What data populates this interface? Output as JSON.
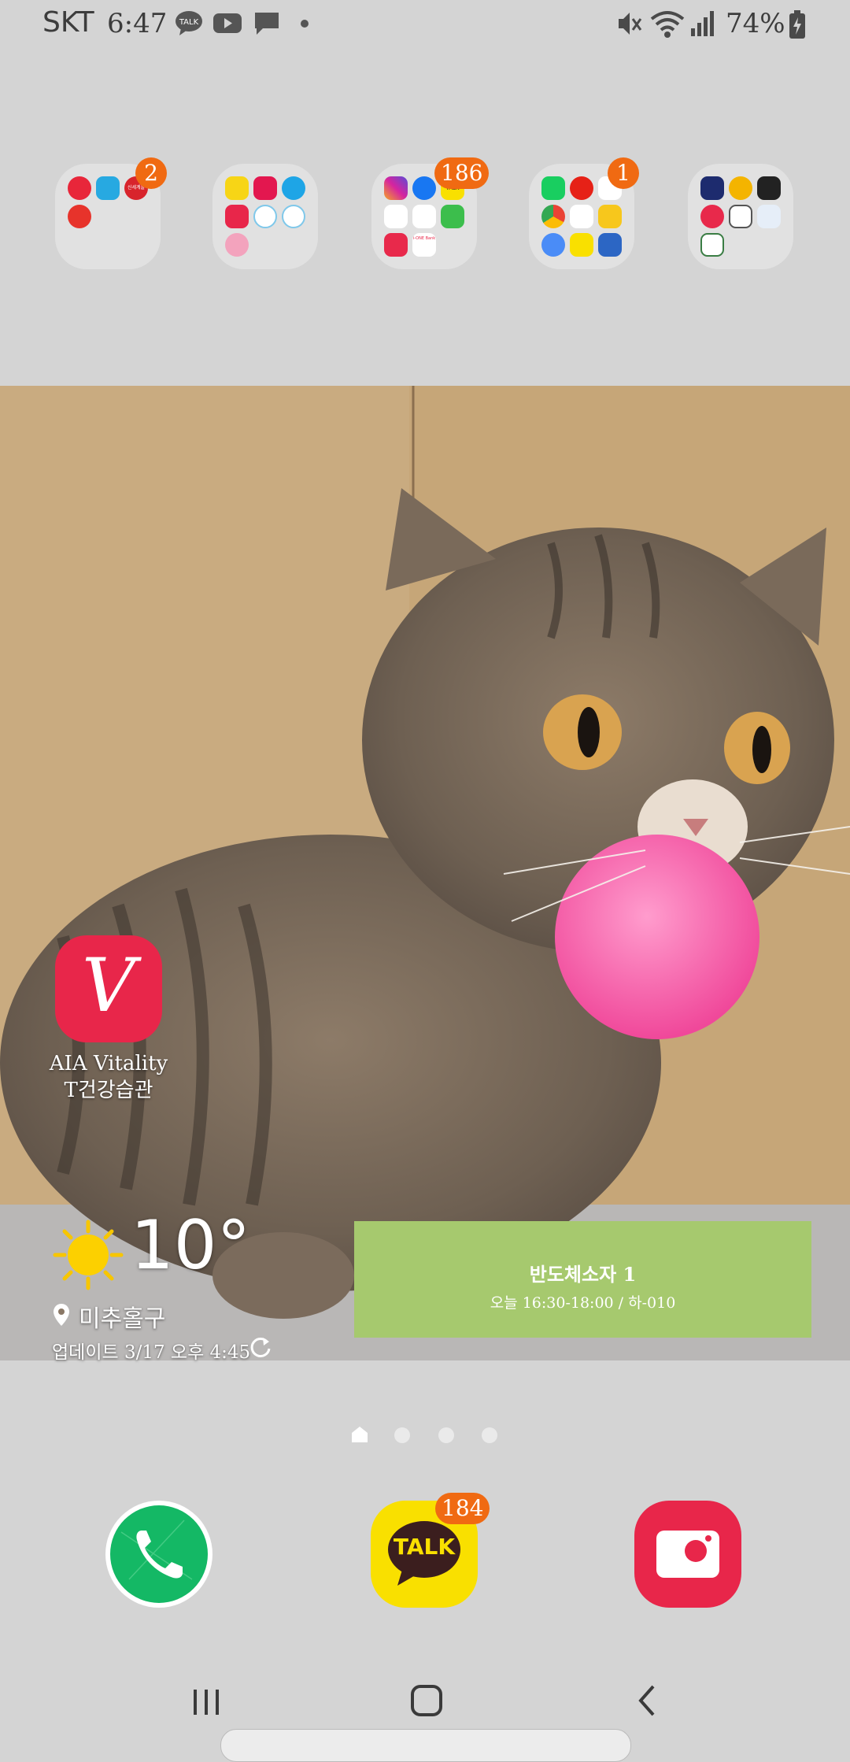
{
  "status_bar": {
    "carrier": "SKT",
    "time": "6:47",
    "battery_percent": "74%",
    "notification_icons": [
      "kakaotalk-icon",
      "youtube-icon",
      "message-icon",
      "dot-icon"
    ],
    "system_icons": [
      "mute-icon",
      "wifi-icon",
      "signal-icon",
      "battery-charging-icon"
    ]
  },
  "folders": [
    {
      "name": "folder-shopping",
      "badge": "2",
      "mini_icon_text": "신세계몰"
    },
    {
      "name": "folder-camera-tools",
      "badge": null
    },
    {
      "name": "folder-social",
      "badge": "186",
      "mini_icon_texts": [
        "TALK",
        "i-ONE Bank"
      ]
    },
    {
      "name": "folder-portal",
      "badge": "1"
    },
    {
      "name": "folder-transport",
      "badge": null
    }
  ],
  "home_app": {
    "label_line1": "AIA Vitality",
    "label_line2": "T건강습관",
    "icon_letter": "V"
  },
  "weather": {
    "temperature": "10°",
    "location": "미추홀구",
    "updated": "업데이트 3/17 오후 4:45"
  },
  "schedule_widget": {
    "title": "반도체소자 1",
    "subtitle": "오늘 16:30-18:00 / 하-010"
  },
  "page_indicator": {
    "pages": 4,
    "current": 1
  },
  "dock": {
    "phone": {
      "name": "phone-icon"
    },
    "kakaotalk": {
      "label": "TALK",
      "badge": "184"
    },
    "camera": {
      "name": "camera-icon"
    }
  },
  "colors": {
    "badge": "#f06a12",
    "schedule_bg": "#a6c96e",
    "vitality_red": "#e8264a",
    "kakao_yellow": "#f9e000",
    "phone_green": "#14b865"
  }
}
